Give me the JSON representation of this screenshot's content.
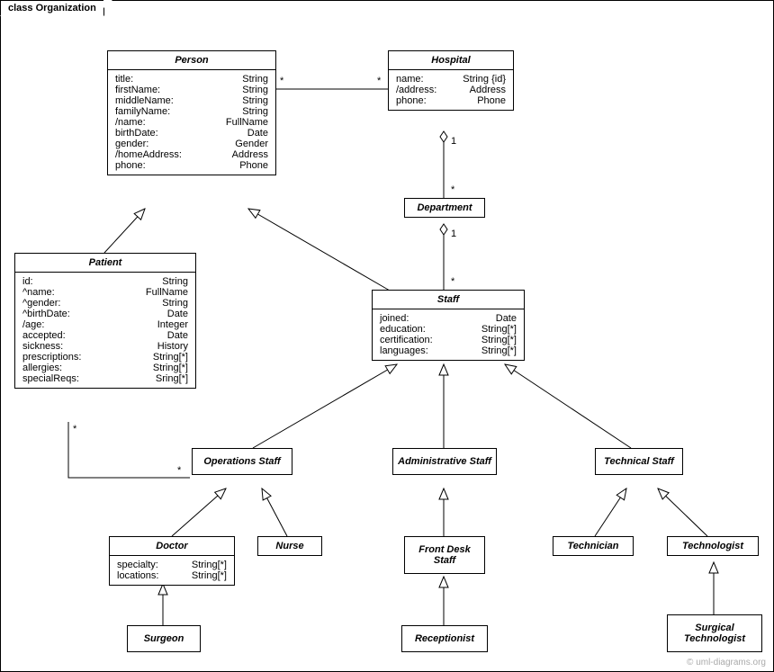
{
  "frame": {
    "title": "class Organization"
  },
  "watermark": "© uml-diagrams.org",
  "classes": {
    "person": {
      "name": "Person",
      "attrs": [
        [
          "title:",
          "String"
        ],
        [
          "firstName:",
          "String"
        ],
        [
          "middleName:",
          "String"
        ],
        [
          "familyName:",
          "String"
        ],
        [
          "/name:",
          "FullName"
        ],
        [
          "birthDate:",
          "Date"
        ],
        [
          "gender:",
          "Gender"
        ],
        [
          "/homeAddress:",
          "Address"
        ],
        [
          "phone:",
          "Phone"
        ]
      ]
    },
    "hospital": {
      "name": "Hospital",
      "attrs": [
        [
          "name:",
          "String {id}"
        ],
        [
          "/address:",
          "Address"
        ],
        [
          "phone:",
          "Phone"
        ]
      ]
    },
    "department": {
      "name": "Department"
    },
    "patient": {
      "name": "Patient",
      "attrs": [
        [
          "id:",
          "String"
        ],
        [
          "^name:",
          "FullName"
        ],
        [
          "^gender:",
          "String"
        ],
        [
          "^birthDate:",
          "Date"
        ],
        [
          "/age:",
          "Integer"
        ],
        [
          "accepted:",
          "Date"
        ],
        [
          "sickness:",
          "History"
        ],
        [
          "prescriptions:",
          "String[*]"
        ],
        [
          "allergies:",
          "String[*]"
        ],
        [
          "specialReqs:",
          "Sring[*]"
        ]
      ]
    },
    "staff": {
      "name": "Staff",
      "attrs": [
        [
          "joined:",
          "Date"
        ],
        [
          "education:",
          "String[*]"
        ],
        [
          "certification:",
          "String[*]"
        ],
        [
          "languages:",
          "String[*]"
        ]
      ]
    },
    "opsStaff": {
      "name": "Operations Staff"
    },
    "adminStaff": {
      "name": "Administrative Staff"
    },
    "techStaff": {
      "name": "Technical Staff"
    },
    "doctor": {
      "name": "Doctor",
      "attrs": [
        [
          "specialty:",
          "String[*]"
        ],
        [
          "locations:",
          "String[*]"
        ]
      ]
    },
    "nurse": {
      "name": "Nurse"
    },
    "frontDesk": {
      "name": "Front Desk Staff"
    },
    "technician": {
      "name": "Technician"
    },
    "technologist": {
      "name": "Technologist"
    },
    "surgeon": {
      "name": "Surgeon"
    },
    "receptionist": {
      "name": "Receptionist"
    },
    "surgTech": {
      "name": "Surgical Technologist"
    }
  },
  "m": {
    "ph1": "*",
    "ph2": "*",
    "hd1": "1",
    "hd2": "*",
    "ds1": "1",
    "ds2": "*",
    "po1": "*",
    "po2": "*"
  }
}
